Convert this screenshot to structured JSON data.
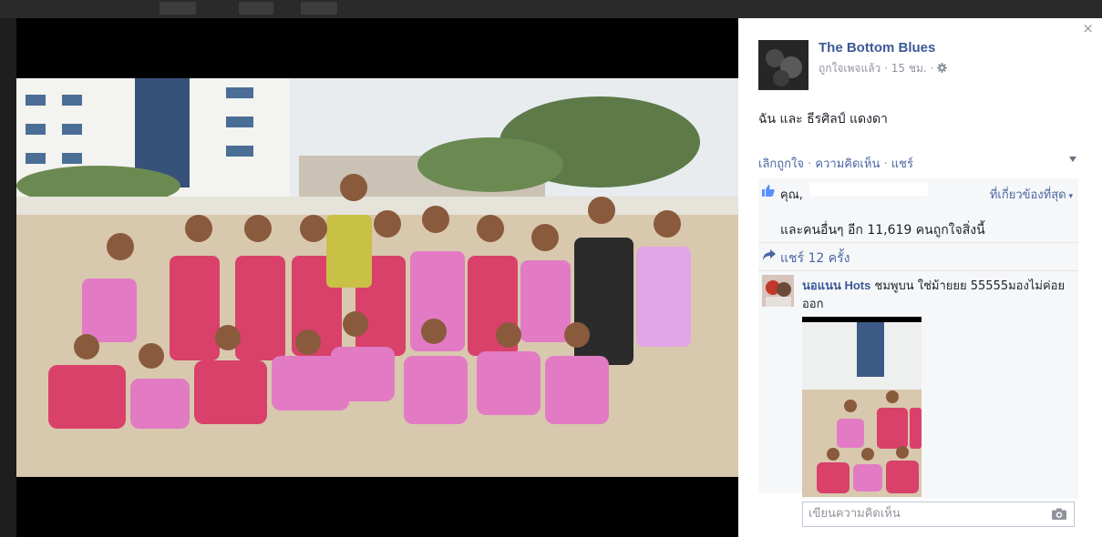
{
  "post": {
    "page_name": "The Bottom Blues",
    "liked_page": "ถูกใจเพจแล้ว",
    "sep": "·",
    "time": "15 ชม.",
    "caption": "ฉัน และ ธีรศิลป์ แดงดา",
    "actions": {
      "unlike": "เลิกถูกใจ",
      "comment": "ความคิดเห็น",
      "share": "แชร์"
    }
  },
  "ufi": {
    "likes_you": "คุณ,",
    "top_sort": "ที่เกี่ยวข้องที่สุด",
    "likes_others_prefix": "และ",
    "likes_others_link": "คนอื่นๆ อีก 11,619 คน",
    "likes_others_suffix": "ถูกใจสิ่งนี้",
    "shares": "แชร์ 12 ครั้ง"
  },
  "comment": {
    "author": "นอแนน Hots",
    "text": "ชมพูบน ใช่ม้ายยย 55555มองไม่ค่อยออก"
  },
  "composer": {
    "placeholder": "เขียนความคิดเห็น"
  },
  "close_label": "×",
  "colors": {
    "link": "#3b5998",
    "muted": "#90949c",
    "panel_bg": "#f6f7f9",
    "viewer_bg": "#000000"
  },
  "icons": [
    "close-icon",
    "gear-icon",
    "chevron-down-icon",
    "like-icon",
    "share-icon",
    "camera-icon"
  ]
}
